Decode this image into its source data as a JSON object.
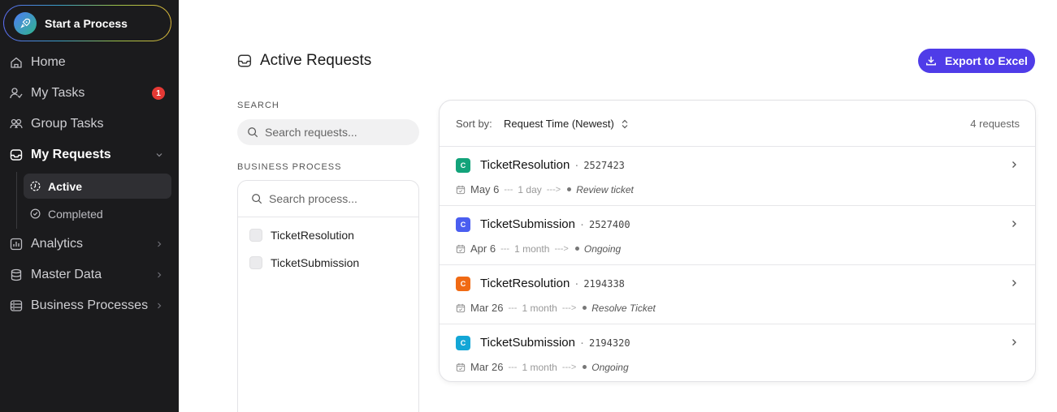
{
  "sidebar": {
    "start_label": "Start a Process",
    "items": [
      {
        "label": "Home",
        "icon": "home-icon"
      },
      {
        "label": "My Tasks",
        "icon": "user-check-icon",
        "badge": "1"
      },
      {
        "label": "Group Tasks",
        "icon": "users-icon"
      },
      {
        "label": "My Requests",
        "icon": "inbox-icon"
      },
      {
        "label": "Analytics",
        "icon": "chart-icon"
      },
      {
        "label": "Master Data",
        "icon": "database-icon"
      },
      {
        "label": "Business Processes",
        "icon": "server-icon"
      }
    ],
    "sub_items": [
      {
        "label": "Active",
        "icon": "clock-icon"
      },
      {
        "label": "Completed",
        "icon": "check-circle-icon"
      }
    ]
  },
  "main": {
    "title": "Active Requests",
    "export_label": "Export to Excel",
    "search_label": "SEARCH",
    "search_placeholder": "Search requests...",
    "process_label": "BUSINESS PROCESS",
    "process_search_placeholder": "Search process...",
    "process_options": [
      "TicketResolution",
      "TicketSubmission"
    ]
  },
  "list": {
    "sort_label": "Sort by:",
    "sort_value": "Request Time (Newest)",
    "count": "4 requests",
    "rows": [
      {
        "icon_letter": "C",
        "color": "#12a37a",
        "name": "TicketResolution",
        "id": "2527423",
        "date": "May 6",
        "duration": "1 day",
        "stage": "Review ticket"
      },
      {
        "icon_letter": "C",
        "color": "#4a5ef0",
        "name": "TicketSubmission",
        "id": "2527400",
        "date": "Apr 6",
        "duration": "1 month",
        "stage": "Ongoing"
      },
      {
        "icon_letter": "C",
        "color": "#f06a14",
        "name": "TicketResolution",
        "id": "2194338",
        "date": "Mar 26",
        "duration": "1 month",
        "stage": "Resolve Ticket"
      },
      {
        "icon_letter": "C",
        "color": "#13a6d6",
        "name": "TicketSubmission",
        "id": "2194320",
        "date": "Mar 26",
        "duration": "1 month",
        "stage": "Ongoing"
      }
    ]
  },
  "text": {
    "dot_sep": "·",
    "dashes": "---",
    "arrow_dashes": "--->"
  }
}
